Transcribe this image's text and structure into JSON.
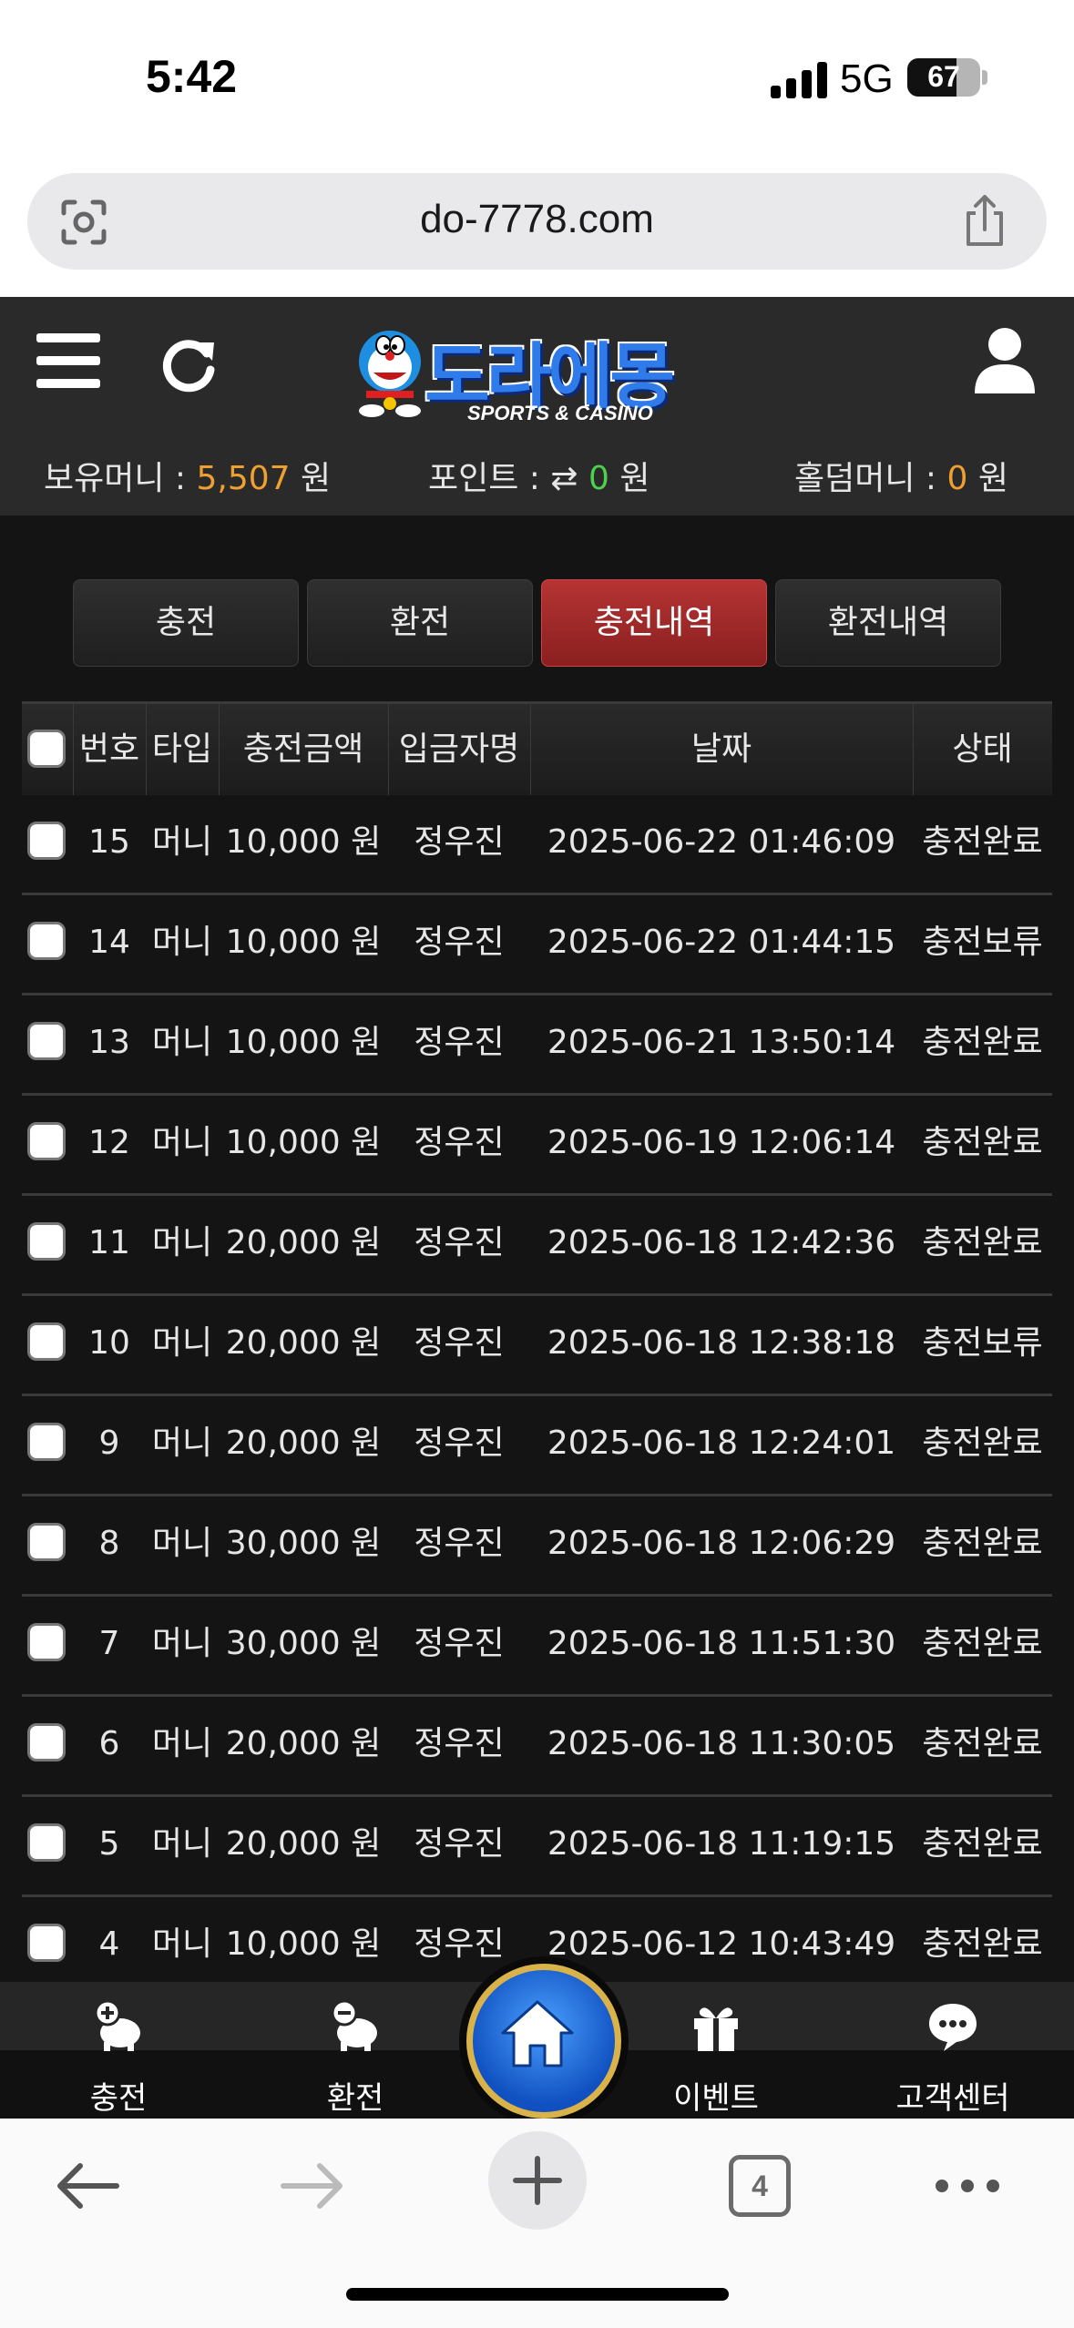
{
  "status_bar": {
    "time": "5:42",
    "network": "5G",
    "battery": "67",
    "battery_level": 0.67
  },
  "browser": {
    "url": "do-7778.com",
    "tab_count": "4"
  },
  "header": {
    "logo_text": "도라에몽",
    "logo_sub": "SPORTS & CASINO",
    "balance_label": "보유머니 : ",
    "balance_value": "5,507",
    "balance_unit": " 원",
    "point_label": "포인트 : ",
    "point_value": "0",
    "point_unit": " 원",
    "holdem_label": "홀덤머니 : ",
    "holdem_value": "0",
    "holdem_unit": " 원"
  },
  "tabs": [
    {
      "label": "충전",
      "active": false
    },
    {
      "label": "환전",
      "active": false
    },
    {
      "label": "충전내역",
      "active": true
    },
    {
      "label": "환전내역",
      "active": false
    }
  ],
  "table": {
    "headers": [
      "번호",
      "타입",
      "충전금액",
      "입금자명",
      "날짜",
      "상태"
    ],
    "rows": [
      {
        "no": "15",
        "type": "머니",
        "amount": "10,000 원",
        "name": "정우진",
        "date": "2025-06-22 01:46:09",
        "status": "충전완료"
      },
      {
        "no": "14",
        "type": "머니",
        "amount": "10,000 원",
        "name": "정우진",
        "date": "2025-06-22 01:44:15",
        "status": "충전보류"
      },
      {
        "no": "13",
        "type": "머니",
        "amount": "10,000 원",
        "name": "정우진",
        "date": "2025-06-21 13:50:14",
        "status": "충전완료"
      },
      {
        "no": "12",
        "type": "머니",
        "amount": "10,000 원",
        "name": "정우진",
        "date": "2025-06-19 12:06:14",
        "status": "충전완료"
      },
      {
        "no": "11",
        "type": "머니",
        "amount": "20,000 원",
        "name": "정우진",
        "date": "2025-06-18 12:42:36",
        "status": "충전완료"
      },
      {
        "no": "10",
        "type": "머니",
        "amount": "20,000 원",
        "name": "정우진",
        "date": "2025-06-18 12:38:18",
        "status": "충전보류"
      },
      {
        "no": "9",
        "type": "머니",
        "amount": "20,000 원",
        "name": "정우진",
        "date": "2025-06-18 12:24:01",
        "status": "충전완료"
      },
      {
        "no": "8",
        "type": "머니",
        "amount": "30,000 원",
        "name": "정우진",
        "date": "2025-06-18 12:06:29",
        "status": "충전완료"
      },
      {
        "no": "7",
        "type": "머니",
        "amount": "30,000 원",
        "name": "정우진",
        "date": "2025-06-18 11:51:30",
        "status": "충전완료"
      },
      {
        "no": "6",
        "type": "머니",
        "amount": "20,000 원",
        "name": "정우진",
        "date": "2025-06-18 11:30:05",
        "status": "충전완료"
      },
      {
        "no": "5",
        "type": "머니",
        "amount": "20,000 원",
        "name": "정우진",
        "date": "2025-06-18 11:19:15",
        "status": "충전완료"
      },
      {
        "no": "4",
        "type": "머니",
        "amount": "10,000 원",
        "name": "정우진",
        "date": "2025-06-12 10:43:49",
        "status": "충전완료"
      }
    ]
  },
  "bottom_nav": [
    {
      "label": "충전",
      "icon": "piggy-bank-plus-icon"
    },
    {
      "label": "환전",
      "icon": "piggy-bank-minus-icon"
    },
    {
      "label": "",
      "icon": "home-icon"
    },
    {
      "label": "이벤트",
      "icon": "gift-icon"
    },
    {
      "label": "고객센터",
      "icon": "chat-support-icon"
    }
  ],
  "colors": {
    "accent_orange": "#f0a030",
    "accent_green": "#4ed04e",
    "active_tab": "#a02828",
    "background": "#141414"
  }
}
